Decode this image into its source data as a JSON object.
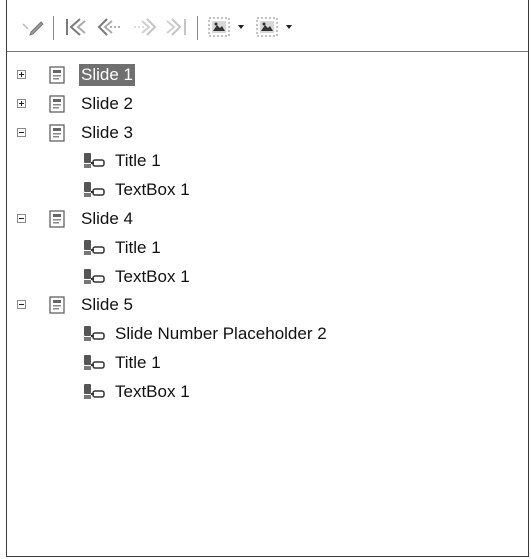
{
  "toolbar": {
    "buttons": [
      {
        "name": "edit-icon"
      },
      {
        "name": "first-icon"
      },
      {
        "name": "previous-icon"
      },
      {
        "name": "next-icon"
      },
      {
        "name": "last-icon"
      },
      {
        "name": "drag-mode-icon"
      },
      {
        "name": "drag-mode-dropdown-icon"
      },
      {
        "name": "show-shapes-icon"
      },
      {
        "name": "show-shapes-dropdown-icon"
      }
    ]
  },
  "tree": {
    "slides": [
      {
        "label": "Slide 1",
        "expanded": false,
        "selected": true,
        "shapes": []
      },
      {
        "label": "Slide 2",
        "expanded": false,
        "selected": false,
        "shapes": []
      },
      {
        "label": "Slide 3",
        "expanded": true,
        "selected": false,
        "shapes": [
          "Title 1",
          "TextBox 1"
        ]
      },
      {
        "label": "Slide 4",
        "expanded": true,
        "selected": false,
        "shapes": [
          "Title 1",
          "TextBox 1"
        ]
      },
      {
        "label": "Slide 5",
        "expanded": true,
        "selected": false,
        "shapes": [
          "Slide Number Placeholder 2",
          "Title 1",
          "TextBox 1"
        ]
      }
    ]
  }
}
